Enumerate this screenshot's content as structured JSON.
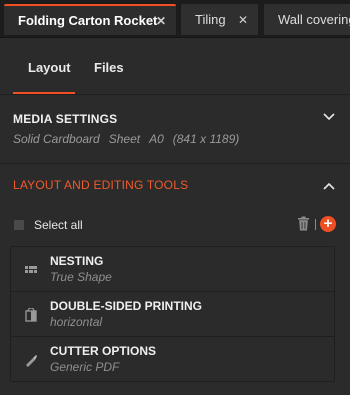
{
  "tabs": [
    {
      "label": "Folding Carton Rocket",
      "close": "✕",
      "active": true
    },
    {
      "label": "Tiling",
      "close": "✕",
      "active": false
    },
    {
      "label": "Wall covering",
      "close": "",
      "active": false
    }
  ],
  "subtabs": {
    "layout": "Layout",
    "files": "Files"
  },
  "media": {
    "title": "MEDIA SETTINGS",
    "material": "Solid Cardboard",
    "type": "Sheet",
    "size": "A0",
    "dimensions": "(841 x 1189)"
  },
  "tools": {
    "title": "LAYOUT AND EDITING TOOLS",
    "select_all": "Select all",
    "add": "+",
    "items": [
      {
        "title": "NESTING",
        "subtitle": "True Shape"
      },
      {
        "title": "DOUBLE-SIDED PRINTING",
        "subtitle": "horizontal"
      },
      {
        "title": "CUTTER OPTIONS",
        "subtitle": "Generic PDF"
      }
    ]
  },
  "colors": {
    "accent": "#f04e23",
    "background": "#2b2b2b"
  }
}
